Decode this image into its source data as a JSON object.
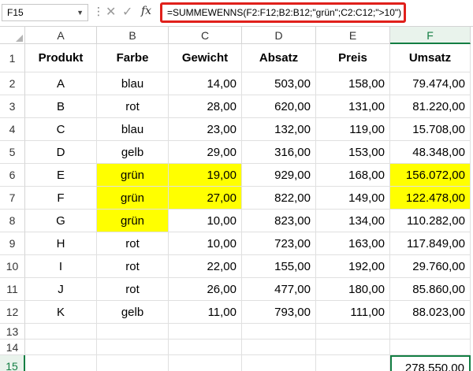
{
  "name_box": "F15",
  "formula": "=SUMMEWENNS(F2:F12;B2:B12;\"grün\";C2:C12;\">10\")",
  "icons": {
    "cancel": "close-icon",
    "confirm": "check-icon",
    "function": "fx-icon"
  },
  "fx_label": "fx",
  "columns": [
    "A",
    "B",
    "C",
    "D",
    "E",
    "F"
  ],
  "rows": [
    "1",
    "2",
    "3",
    "4",
    "5",
    "6",
    "7",
    "8",
    "9",
    "10",
    "11",
    "12",
    "13",
    "14",
    "15"
  ],
  "headers": [
    "Produkt",
    "Farbe",
    "Gewicht",
    "Absatz",
    "Preis",
    "Umsatz"
  ],
  "data": [
    [
      "A",
      "blau",
      "14,00",
      "503,00",
      "158,00",
      "79.474,00"
    ],
    [
      "B",
      "rot",
      "28,00",
      "620,00",
      "131,00",
      "81.220,00"
    ],
    [
      "C",
      "blau",
      "23,00",
      "132,00",
      "119,00",
      "15.708,00"
    ],
    [
      "D",
      "gelb",
      "29,00",
      "316,00",
      "153,00",
      "48.348,00"
    ],
    [
      "E",
      "grün",
      "19,00",
      "929,00",
      "168,00",
      "156.072,00"
    ],
    [
      "F",
      "grün",
      "27,00",
      "822,00",
      "149,00",
      "122.478,00"
    ],
    [
      "G",
      "grün",
      "10,00",
      "823,00",
      "134,00",
      "110.282,00"
    ],
    [
      "H",
      "rot",
      "10,00",
      "723,00",
      "163,00",
      "117.849,00"
    ],
    [
      "I",
      "rot",
      "22,00",
      "155,00",
      "192,00",
      "29.760,00"
    ],
    [
      "J",
      "rot",
      "26,00",
      "477,00",
      "180,00",
      "85.860,00"
    ],
    [
      "K",
      "gelb",
      "11,00",
      "793,00",
      "111,00",
      "88.023,00"
    ]
  ],
  "result": "278.550,00",
  "highlight_color": "#ffff00",
  "selection_color": "#137e43",
  "selected_cell": "F15"
}
